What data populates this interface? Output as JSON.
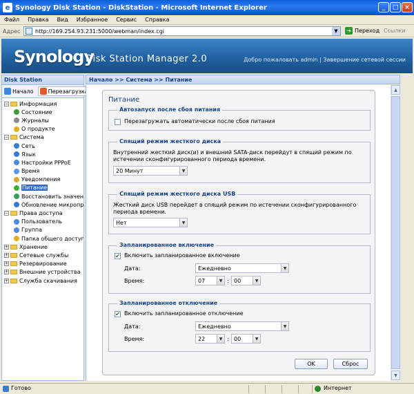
{
  "window": {
    "title": "Synology Disk Station - DiskStation - Microsoft Internet Explorer"
  },
  "menu": [
    "Файл",
    "Правка",
    "Вид",
    "Избранное",
    "Сервис",
    "Справка"
  ],
  "address": {
    "label": "Адрес",
    "url": "http://169.254.93.231:5000/webman/index.cgi",
    "go": "Переход",
    "links": "Ссылки"
  },
  "header": {
    "logo": "Synology",
    "product": "Disk Station Manager 2.0",
    "welcome": "Добро пожаловать admin | Завершение сетевой сессии"
  },
  "left": {
    "title": "Disk Station",
    "toolbar": {
      "home": "Начало",
      "reboot": "Перезагрузка"
    },
    "tree": [
      {
        "label": "Информация",
        "type": "folder",
        "level": 0,
        "sign": "−"
      },
      {
        "label": "Состояние",
        "type": "leaf",
        "level": 1,
        "color": "#3c9a3c"
      },
      {
        "label": "Журналы",
        "type": "leaf",
        "level": 1,
        "color": "#8a8a8a"
      },
      {
        "label": "О продукте",
        "type": "leaf",
        "level": 1,
        "color": "#e0b020"
      },
      {
        "label": "Система",
        "type": "folder",
        "level": 0,
        "sign": "−"
      },
      {
        "label": "Сеть",
        "type": "leaf",
        "level": 1,
        "color": "#3a7ad0"
      },
      {
        "label": "Язык",
        "type": "leaf",
        "level": 1,
        "color": "#3a7ad0"
      },
      {
        "label": "Настройки PPPoE",
        "type": "leaf",
        "level": 1,
        "color": "#4a8ad8"
      },
      {
        "label": "Время",
        "type": "leaf",
        "level": 1,
        "color": "#5a9ae0"
      },
      {
        "label": "Уведомления",
        "type": "leaf",
        "level": 1,
        "color": "#d8a830"
      },
      {
        "label": "Питание",
        "type": "leaf",
        "level": 1,
        "color": "#3cae3c",
        "selected": true
      },
      {
        "label": "Восстановить значения",
        "type": "leaf",
        "level": 1,
        "color": "#3a9a5a"
      },
      {
        "label": "Обновление микропрограммы",
        "type": "leaf",
        "level": 1,
        "color": "#3a7ad0"
      },
      {
        "label": "Права доступа",
        "type": "folder",
        "level": 0,
        "sign": "−"
      },
      {
        "label": "Пользователь",
        "type": "leaf",
        "level": 1,
        "color": "#4a8ad8"
      },
      {
        "label": "Группа",
        "type": "leaf",
        "level": 1,
        "color": "#4a8ad8"
      },
      {
        "label": "Папка общего доступа",
        "type": "leaf",
        "level": 1,
        "color": "#e0b020"
      },
      {
        "label": "Хранение",
        "type": "folder",
        "level": 0,
        "sign": "+"
      },
      {
        "label": "Сетевые службы",
        "type": "folder",
        "level": 0,
        "sign": "+"
      },
      {
        "label": "Резервирование",
        "type": "folder",
        "level": 0,
        "sign": "+"
      },
      {
        "label": "Внешние устройства",
        "type": "folder",
        "level": 0,
        "sign": "+"
      },
      {
        "label": "Служба скачивания",
        "type": "folder",
        "level": 0,
        "sign": "+"
      }
    ]
  },
  "breadcrumb": "Начало >> Система >> Питание",
  "power": {
    "title": "Питание",
    "autostart": {
      "legend": "Автозапуск после сбоя питания",
      "checkbox": "Перезагружать автоматически после сбоя питания",
      "checked": false
    },
    "hdd_sleep": {
      "legend": "Спящий режим жесткого диска",
      "desc": "Внутренний жесткий диск(и) и внешний SATA-диск перейдут в спящий режим по истечении сконфигурированного периода времени.",
      "value": "20 Минут"
    },
    "usb_sleep": {
      "legend": "Спящий режим жесткого диска USB",
      "desc": "Жесткий диск USB перейдет в спящий режим по истечении сконфигурированного периода времени.",
      "value": "Нет"
    },
    "power_on": {
      "legend": "Запланированное включение",
      "checkbox": "Включить запланированное включение",
      "checked": true,
      "date_label": "Дата:",
      "date": "Ежедневно",
      "time_label": "Время:",
      "hour": "07",
      "minute": "00"
    },
    "power_off": {
      "legend": "Запланированное отключение",
      "checkbox": "Включить запланированное отключение",
      "checked": true,
      "date_label": "Дата:",
      "date": "Ежедневно",
      "time_label": "Время:",
      "hour": "22",
      "minute": "00"
    },
    "ok": "OK",
    "reset": "Сброс"
  },
  "status": {
    "left": "Готово",
    "zone": "Интернет"
  }
}
